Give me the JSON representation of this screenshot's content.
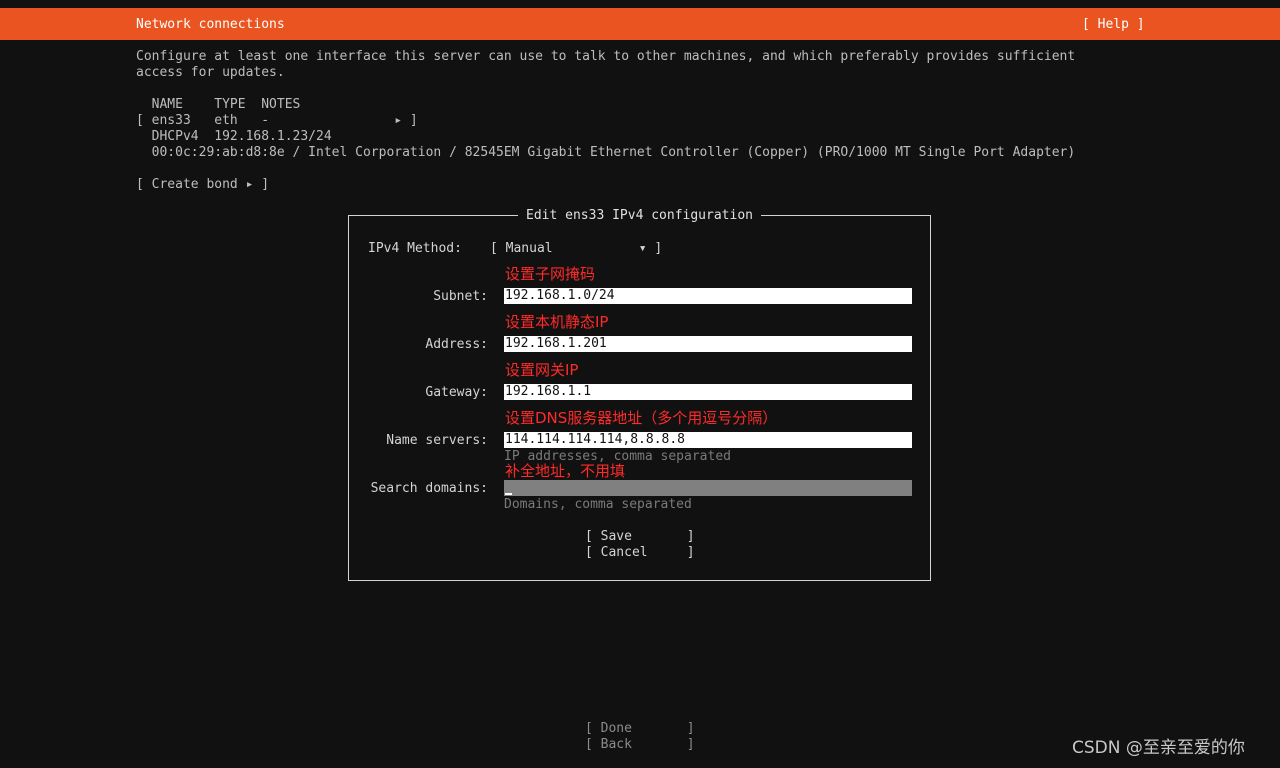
{
  "header": {
    "title": "Network connections",
    "help": "[ Help ]"
  },
  "description": {
    "line1": "Configure at least one interface this server can use to talk to other machines, and which preferably provides sufficient",
    "line2": "access for updates."
  },
  "interfaces": {
    "columns_line": "  NAME    TYPE  NOTES",
    "row_line": "[ ens33   eth   -                ▸ ]",
    "dhcp_line": "  DHCPv4  192.168.1.23/24",
    "hw_line": "  00:0c:29:ab:d8:8e / Intel Corporation / 82545EM Gigabit Ethernet Controller (Copper) (PRO/1000 MT Single Port Adapter)"
  },
  "create_bond": "[ Create bond ▸ ]",
  "dialog": {
    "title": "Edit ens33 IPv4 configuration",
    "method_label": "IPv4 Method:",
    "method_value": "[ Manual           ▾ ]",
    "subnet_label": "Subnet:",
    "subnet_value": "192.168.1.0/24",
    "address_label": "Address:",
    "address_value": "192.168.1.201",
    "gateway_label": "Gateway:",
    "gateway_value": "192.168.1.1",
    "nameservers_label": "Name servers:",
    "nameservers_value": "114.114.114.114,8.8.8.8",
    "nameservers_hint": "IP addresses, comma separated",
    "search_label": "Search domains:",
    "search_value": "",
    "search_hint": "Domains, comma separated",
    "save": "[ Save       ]",
    "cancel": "[ Cancel     ]"
  },
  "annotations": {
    "subnet": "设置子网掩码",
    "address": "设置本机静态IP",
    "gateway": "设置网关IP",
    "nameservers": "设置DNS服务器地址（多个用逗号分隔）",
    "search": "补全地址，不用填"
  },
  "footer": {
    "done": "[ Done       ]",
    "back": "[ Back       ]"
  },
  "watermark": "CSDN @至亲至爱的你",
  "colors": {
    "header": "#e95420",
    "background": "#111111",
    "annotation": "#ff2a2a"
  }
}
